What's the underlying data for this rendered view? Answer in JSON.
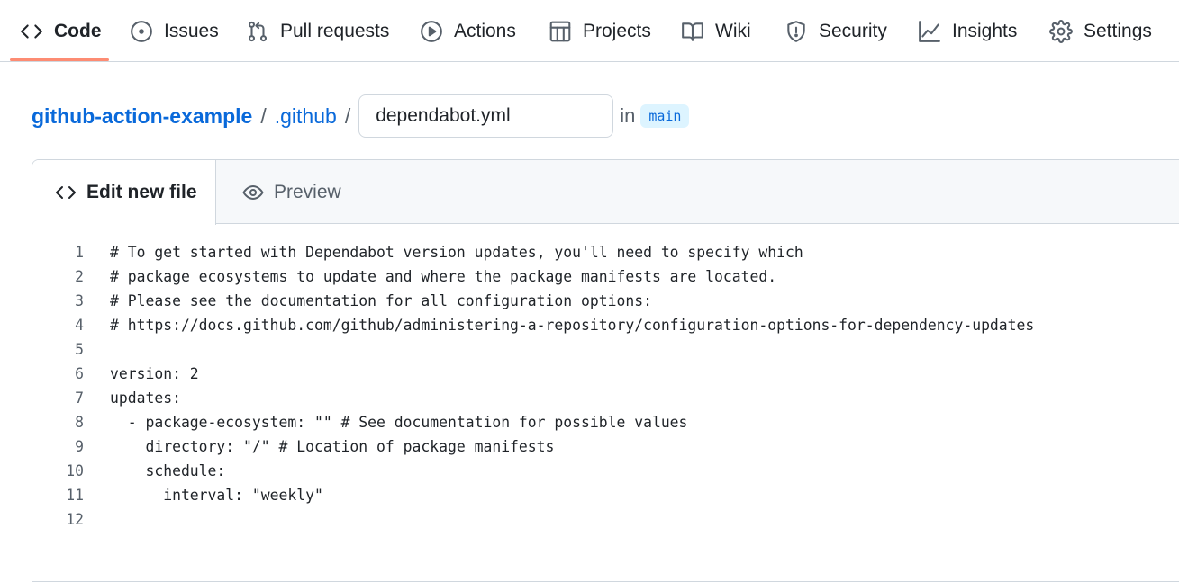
{
  "nav": {
    "items": [
      {
        "label": "Code",
        "icon": "code-icon",
        "active": true
      },
      {
        "label": "Issues",
        "icon": "issue-circle-icon"
      },
      {
        "label": "Pull requests",
        "icon": "pull-request-icon"
      },
      {
        "label": "Actions",
        "icon": "play-circle-icon"
      },
      {
        "label": "Projects",
        "icon": "table-icon"
      },
      {
        "label": "Wiki",
        "icon": "book-icon"
      },
      {
        "label": "Security",
        "icon": "shield-icon"
      },
      {
        "label": "Insights",
        "icon": "graph-icon"
      },
      {
        "label": "Settings",
        "icon": "gear-icon"
      }
    ],
    "active_color": "#fd8c73"
  },
  "breadcrumb": {
    "repo": "github-action-example",
    "sep1": "/",
    "folder": ".github",
    "sep2": "/",
    "filename_value": "dependabot.yml",
    "in_label": "in",
    "branch": "main"
  },
  "editor": {
    "tabs": [
      {
        "label": "Edit new file",
        "icon": "code-icon",
        "active": true
      },
      {
        "label": "Preview",
        "icon": "eye-icon"
      }
    ],
    "lines": [
      {
        "n": "1",
        "text": "# To get started with Dependabot version updates, you'll need to specify which"
      },
      {
        "n": "2",
        "text": "# package ecosystems to update and where the package manifests are located."
      },
      {
        "n": "3",
        "text": "# Please see the documentation for all configuration options:"
      },
      {
        "n": "4",
        "text": "# https://docs.github.com/github/administering-a-repository/configuration-options-for-dependency-updates"
      },
      {
        "n": "5",
        "text": ""
      },
      {
        "n": "6",
        "text": "version: 2"
      },
      {
        "n": "7",
        "text": "updates:"
      },
      {
        "n": "8",
        "text": "  - package-ecosystem: \"\" # See documentation for possible values"
      },
      {
        "n": "9",
        "text": "    directory: \"/\" # Location of package manifests"
      },
      {
        "n": "10",
        "text": "    schedule:"
      },
      {
        "n": "11",
        "text": "      interval: \"weekly\""
      },
      {
        "n": "12",
        "text": ""
      }
    ]
  },
  "colors": {
    "link": "#0969da",
    "muted": "#57606a",
    "border": "#d0d7de",
    "branch_bg": "#ddf4ff"
  }
}
